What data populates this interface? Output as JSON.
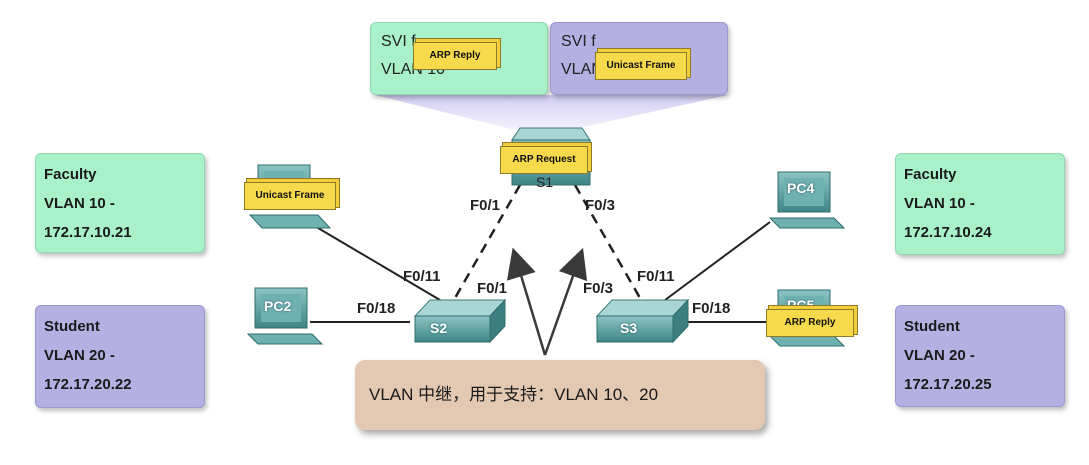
{
  "svi": [
    {
      "line1": "SVI f",
      "line2": "VLAN 10"
    },
    {
      "line1": "SVI f",
      "line2": "VLAN 20"
    }
  ],
  "hosts": {
    "pc1": {
      "label": "Faculty",
      "vlan": "VLAN 10 -",
      "ip": "172.17.10.21"
    },
    "pc2": {
      "label": "Student",
      "vlan": "VLAN 20 -",
      "ip": "172.17.20.22"
    },
    "pc4": {
      "label": "Faculty",
      "vlan": "VLAN 10 -",
      "ip": "172.17.10.24"
    },
    "pc5": {
      "label": "Student",
      "vlan": "VLAN 20 -",
      "ip": "172.17.20.25"
    }
  },
  "devices": {
    "s1": "S1",
    "s2": "S2",
    "s3": "S3",
    "pc2": "PC2",
    "pc4": "PC4",
    "pc5": "PC5"
  },
  "ports": {
    "s1_left": "F0/1",
    "s1_right": "F0/3",
    "s2_up": "F0/1",
    "s2_pc1": "F0/11",
    "s2_pc2": "F0/18",
    "s3_up": "F0/3",
    "s3_pc4": "F0/11",
    "s3_pc5": "F0/18"
  },
  "envelopes": {
    "arp_reply_top": "ARP Reply",
    "unicast_top": "Unicast Frame",
    "arp_request": "ARP Request",
    "unicast_pc1": "Unicast Frame",
    "arp_reply_pc5": "ARP Reply"
  },
  "trunk": "VLAN 中继，用于支持：VLAN 10、20",
  "colors": {
    "vlan10": "#a9f1c8",
    "vlan20": "#b5b0e2",
    "envelope": "#f7d94c",
    "device": "#4f9a9b",
    "trunk_box": "#e3c8b2"
  }
}
